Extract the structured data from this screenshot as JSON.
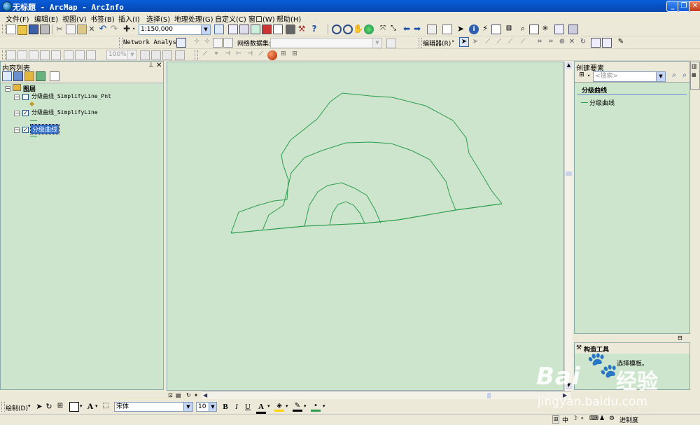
{
  "window": {
    "title": "无标题 - ArcMap - ArcInfo",
    "minimize": "_",
    "maximize": "❐",
    "close": "✕"
  },
  "menu": [
    "文件(F)",
    "编辑(E)",
    "视图(V)",
    "书签(B)",
    "插入(I)",
    "选择(S)",
    "地理处理(G)",
    "自定义(C)",
    "窗口(W)",
    "帮助(H)"
  ],
  "toolbar": {
    "scale": "1:150,000",
    "network_analyst": "Network Analyst",
    "network_dataset_label": "网络数据集:",
    "editor": "编辑器(R)",
    "zoom": "100%"
  },
  "toc": {
    "title": "内容列表",
    "root": "图层",
    "layers": [
      {
        "name": "分级曲线_SimplifyLine_Pnt",
        "checked": false
      },
      {
        "name": "分级曲线_SimplifyLine",
        "checked": true
      },
      {
        "name": "分级曲线",
        "checked": true,
        "selected": true
      }
    ]
  },
  "create_features": {
    "title": "创建要素",
    "search_placeholder": "<搜索>",
    "group": "分级曲线",
    "template": "分级曲线"
  },
  "construct_tools": {
    "title": "构造工具",
    "hint": "选择模板。"
  },
  "draw": {
    "label": "绘制(D)",
    "font": "宋体",
    "size": "10",
    "bold": "B",
    "italic": "I",
    "underline": "U",
    "font_color": "A"
  },
  "status": {
    "text": "进制度",
    "ime": "中"
  },
  "watermark": {
    "brand": "Bai",
    "brand2": "经验",
    "url": "jingyan.baidu.com"
  },
  "colors": {
    "map_bg": "#cde5cd",
    "line": "#2e9e4e",
    "title_bar": "#0553c9"
  }
}
